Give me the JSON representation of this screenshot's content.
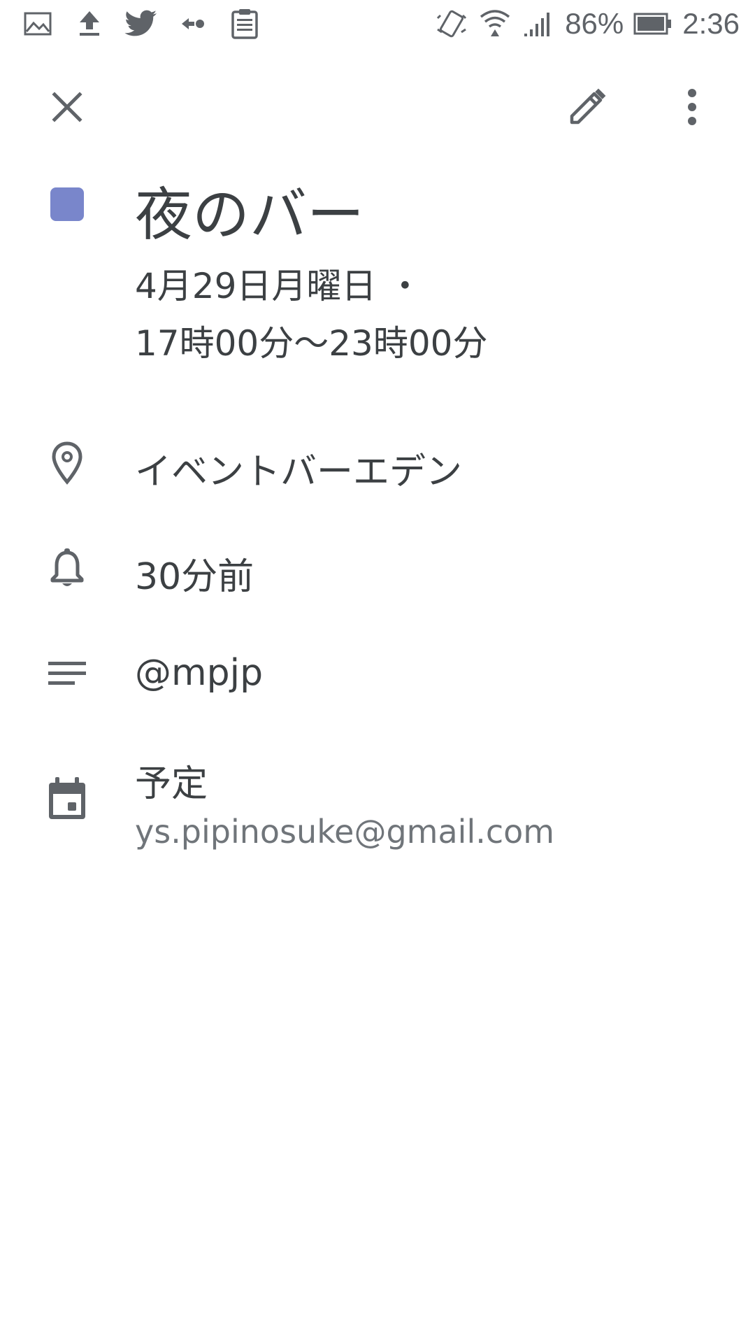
{
  "status_bar": {
    "left_icons": [
      "gallery-icon",
      "upload-icon",
      "twitter-icon",
      "cast-icon",
      "clipboard-icon"
    ],
    "right_icons": [
      "vibrate-icon",
      "wifi-icon",
      "signal-icon",
      "battery-icon"
    ],
    "battery_percent": "86%",
    "time": "2:36"
  },
  "toolbar": {
    "close_icon": "close-icon",
    "edit_icon": "pencil-icon",
    "more_icon": "more-vert-icon"
  },
  "event": {
    "color": "#7986cb",
    "title": "夜のバー",
    "date_line": "4月29日月曜日 ・",
    "time_line": "17時00分～23時00分",
    "location": "イベントバーエデン",
    "reminder": "30分前",
    "description": "@mpjp",
    "calendar_name": "予定",
    "calendar_account": "ys.pipinosuke@gmail.com"
  },
  "colors": {
    "icon_gray": "#5f6368",
    "text_dark": "#3c4043",
    "text_secondary": "#70757a"
  }
}
